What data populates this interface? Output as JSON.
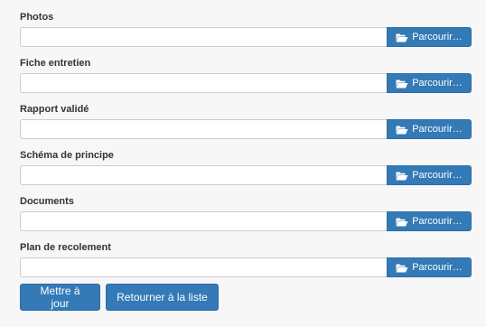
{
  "fields": [
    {
      "label": "Photos",
      "value": "",
      "button": "Parcourir…",
      "icon": "folder-open-icon"
    },
    {
      "label": "Fiche entretien",
      "value": "",
      "button": "Parcourir…",
      "icon": "folder-open-icon"
    },
    {
      "label": "Rapport validé",
      "value": "",
      "button": "Parcourir…",
      "icon": "folder-open-icon"
    },
    {
      "label": "Schéma de principe",
      "value": "",
      "button": "Parcourir…",
      "icon": "folder-open-icon"
    },
    {
      "label": "Documents",
      "value": "",
      "button": "Parcourir…",
      "icon": "folder-open-icon"
    },
    {
      "label": "Plan de recolement",
      "value": "",
      "button": "Parcourir…",
      "icon": "folder-open-icon"
    }
  ],
  "actions": {
    "update_label": "Mettre à jour",
    "back_label": "Retourner à la liste"
  },
  "colors": {
    "primary": "#337ab7",
    "primary_border": "#2e6da4",
    "background": "#f7f7f7"
  }
}
